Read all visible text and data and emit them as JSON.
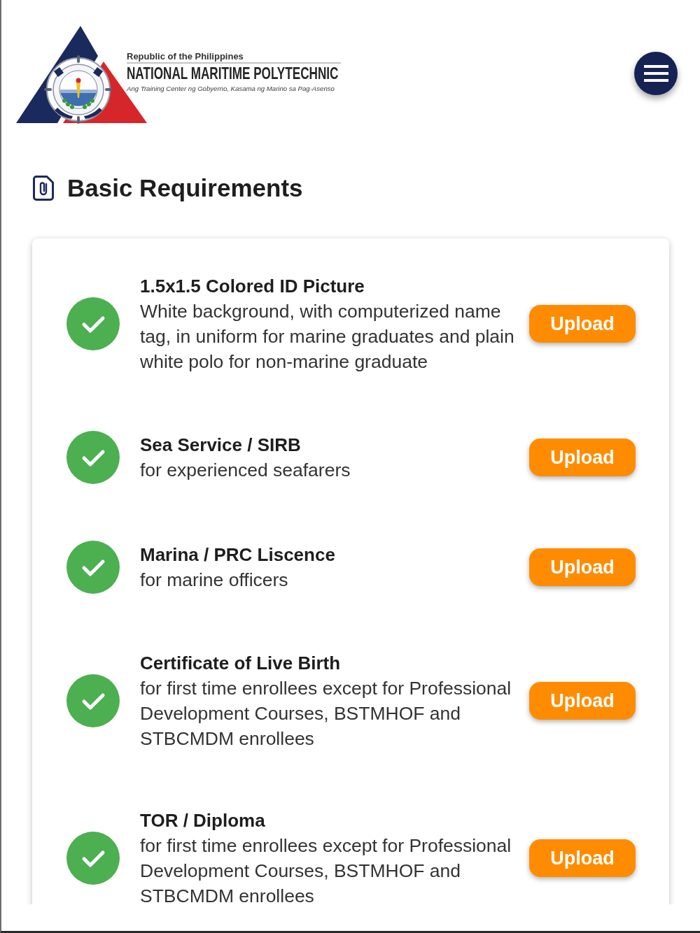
{
  "header": {
    "logo": {
      "country": "Republic of the Philippines",
      "name": "NATIONAL MARITIME POLYTECHNIC",
      "tagline": "Ang Training Center ng Gobyerno, Kasama ng Marino sa Pag-Asenso"
    }
  },
  "page_title": "Basic Requirements",
  "requirements": [
    {
      "title": "1.5x1.5 Colored ID Picture",
      "description": "White background, with computerized name tag, in uniform for marine graduates and plain white polo for non-marine graduate",
      "complete": true,
      "button": "Upload"
    },
    {
      "title": "Sea Service / SIRB",
      "description": "for experienced seafarers",
      "complete": true,
      "button": "Upload"
    },
    {
      "title": "Marina / PRC Liscence",
      "description": "for marine officers",
      "complete": true,
      "button": "Upload"
    },
    {
      "title": "Certificate of Live Birth",
      "description": "for first time enrollees except for Professional Development Courses, BSTMHOF and STBCMDM enrollees",
      "complete": true,
      "button": "Upload"
    },
    {
      "title": "TOR / Diploma",
      "description": "for first time enrollees except for Professional Development Courses, BSTMHOF and STBCMDM enrollees",
      "complete": true,
      "button": "Upload"
    }
  ]
}
